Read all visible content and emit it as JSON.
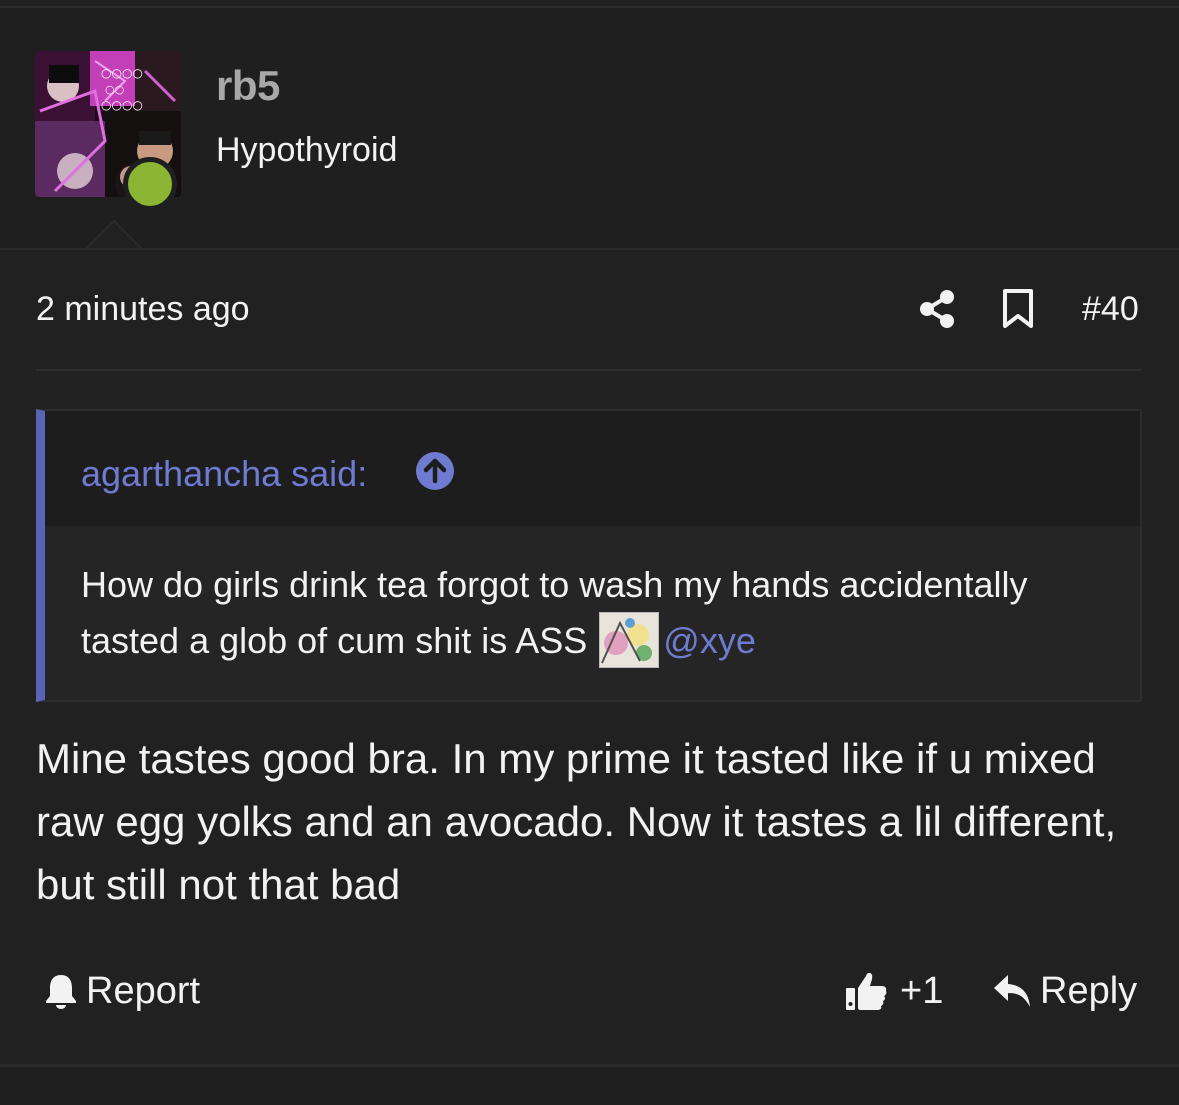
{
  "user": {
    "name": "rb5",
    "title": "Hypothyroid",
    "online_color": "#8bb533"
  },
  "post": {
    "time": "2 minutes ago",
    "number": "#40",
    "body": "Mine tastes good bra. In my prime it tasted like if u mixed raw egg yolks and an avocado. Now it tastes a lil different, but still not that bad"
  },
  "quote": {
    "author_label": "agarthancha said:",
    "text": "How do girls drink tea forgot to wash my hands accidentally tasted a glob of cum shit is ASS",
    "mention": "@xye",
    "accent_color": "#5965b4"
  },
  "actions": {
    "report_label": "Report",
    "like_count": "+1",
    "reply_label": "Reply"
  },
  "icons": {
    "share": "share-icon",
    "bookmark": "bookmark-icon",
    "expand": "arrow-up-circle-icon",
    "report": "bell-icon",
    "like": "thumbs-up-icon",
    "reply": "reply-arrow-icon"
  }
}
